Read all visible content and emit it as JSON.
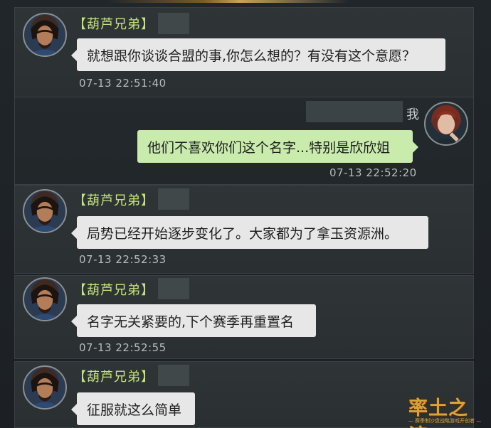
{
  "messages": [
    {
      "sender": "【葫芦兄弟】",
      "text": "就想跟你谈谈合盟的事,你怎么想的？有没有这个意愿？",
      "time": "07-13 22:51:40"
    },
    {
      "sender": "我",
      "text": "他们不喜欢你们这个名字...特别是欣欣姐",
      "time": "07-13 22:52:20"
    },
    {
      "sender": "【葫芦兄弟】",
      "text": "局势已经开始逐步变化了。大家都为了拿玉资源洲。",
      "time": "07-13 22:52:33"
    },
    {
      "sender": "【葫芦兄弟】",
      "text": "名字无关紧要的,下个赛季再重置名",
      "time": "07-13 22:52:55"
    },
    {
      "sender": "【葫芦兄弟】",
      "text": "征服就这么简单",
      "time": ""
    }
  ],
  "logo": {
    "title": "率土之滨",
    "subtitle": "— 赛季制沙盘战略游戏开创者 —"
  },
  "colors": {
    "name": "#c7e27a",
    "bubble_other": "#e7e7e7",
    "bubble_me": "#c9ebac",
    "background": "#1b1f22"
  }
}
